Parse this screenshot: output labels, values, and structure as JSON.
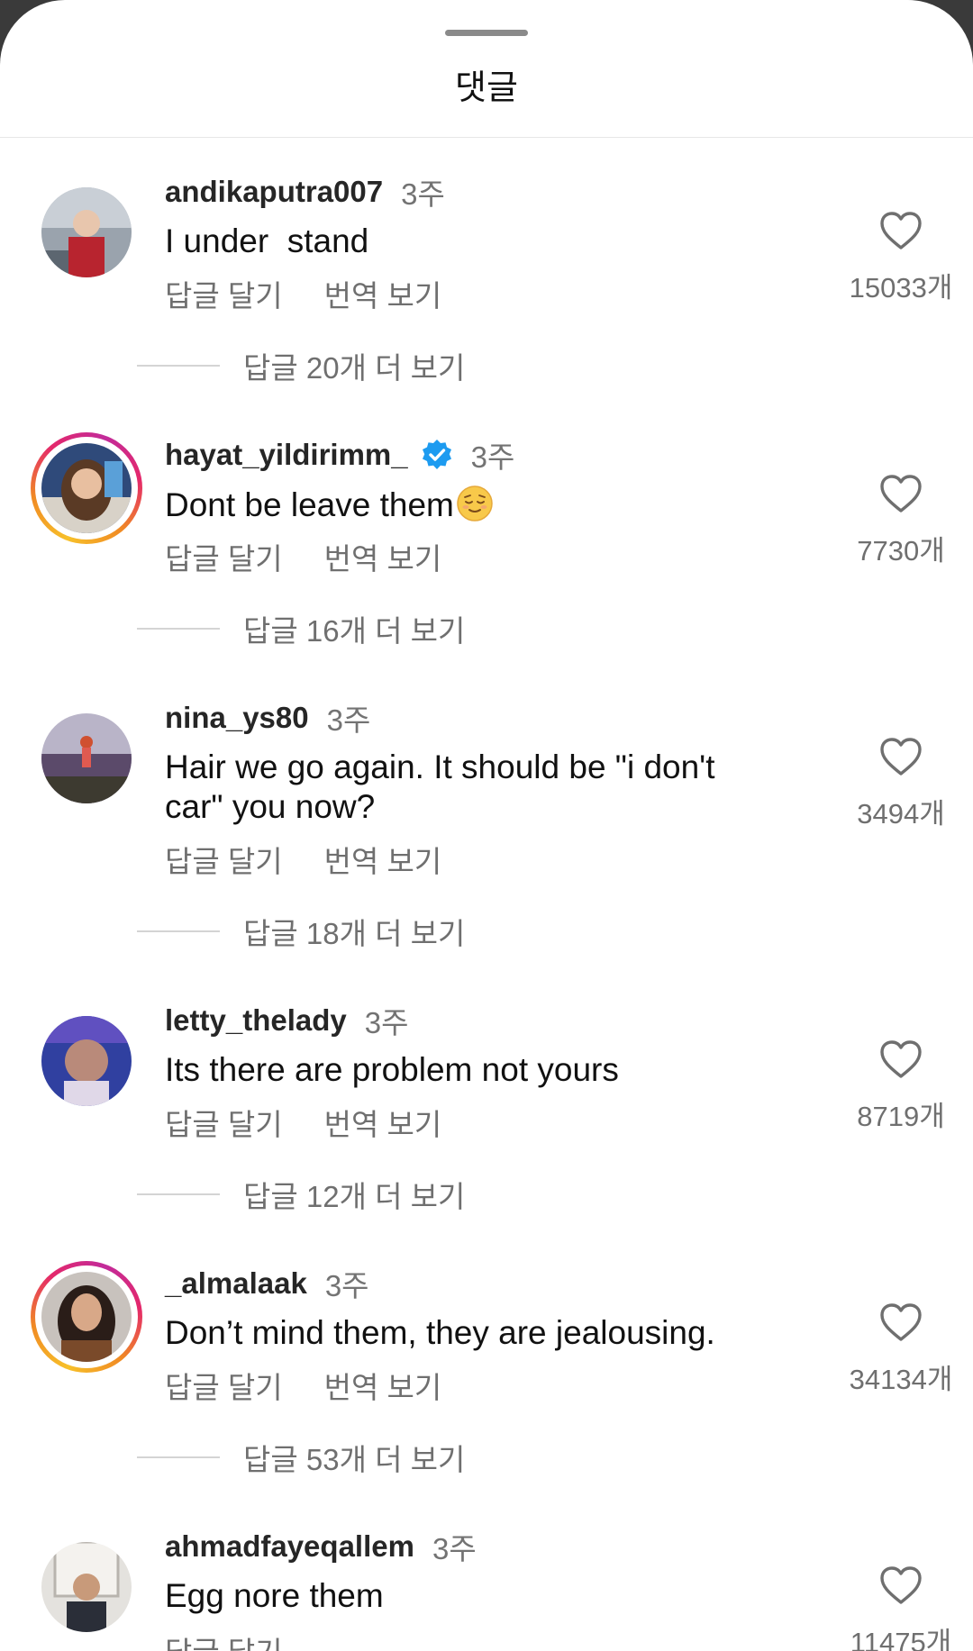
{
  "sheet": {
    "title": "댓글"
  },
  "comments": [
    {
      "username": "andikaputra007",
      "time": "3주",
      "text": "I under  stand",
      "verified": false,
      "story_ring": false,
      "reply_label": "답글 달기",
      "translate_label": "번역 보기",
      "more_replies": "답글 20개 더 보기",
      "likes": "15033개"
    },
    {
      "username": "hayat_yildirimm_",
      "time": "3주",
      "text": "Dont be leave them",
      "emoji": "relieved-face",
      "verified": true,
      "story_ring": true,
      "reply_label": "답글 달기",
      "translate_label": "번역 보기",
      "more_replies": "답글 16개 더 보기",
      "likes": "7730개"
    },
    {
      "username": "nina_ys80",
      "time": "3주",
      "text": "Hair we go again. It should be \"i don't car\" you now?",
      "verified": false,
      "story_ring": false,
      "reply_label": "답글 달기",
      "translate_label": "번역 보기",
      "more_replies": "답글 18개 더 보기",
      "likes": "3494개"
    },
    {
      "username": "letty_thelady",
      "time": "3주",
      "text": "Its there are problem not yours",
      "verified": false,
      "story_ring": false,
      "reply_label": "답글 달기",
      "translate_label": "번역 보기",
      "more_replies": "답글 12개 더 보기",
      "likes": "8719개"
    },
    {
      "username": "_almalaak",
      "time": "3주",
      "text": "Don’t mind them, they are jealousing.",
      "verified": false,
      "story_ring": true,
      "reply_label": "답글 달기",
      "translate_label": "번역 보기",
      "more_replies": "답글 53개 더 보기",
      "likes": "34134개"
    },
    {
      "username": "ahmadfayeqallem",
      "time": "3주",
      "text": "Egg nore them",
      "verified": false,
      "story_ring": false,
      "reply_label": "답글 달기",
      "likes": "11475개"
    }
  ],
  "icons": {
    "like": "heart-outline-icon",
    "verified": "verified-badge-icon"
  },
  "colors": {
    "verified": "#1d9bf0",
    "story_ring_start": "#f7c02a",
    "story_ring_end": "#c22b9a"
  }
}
